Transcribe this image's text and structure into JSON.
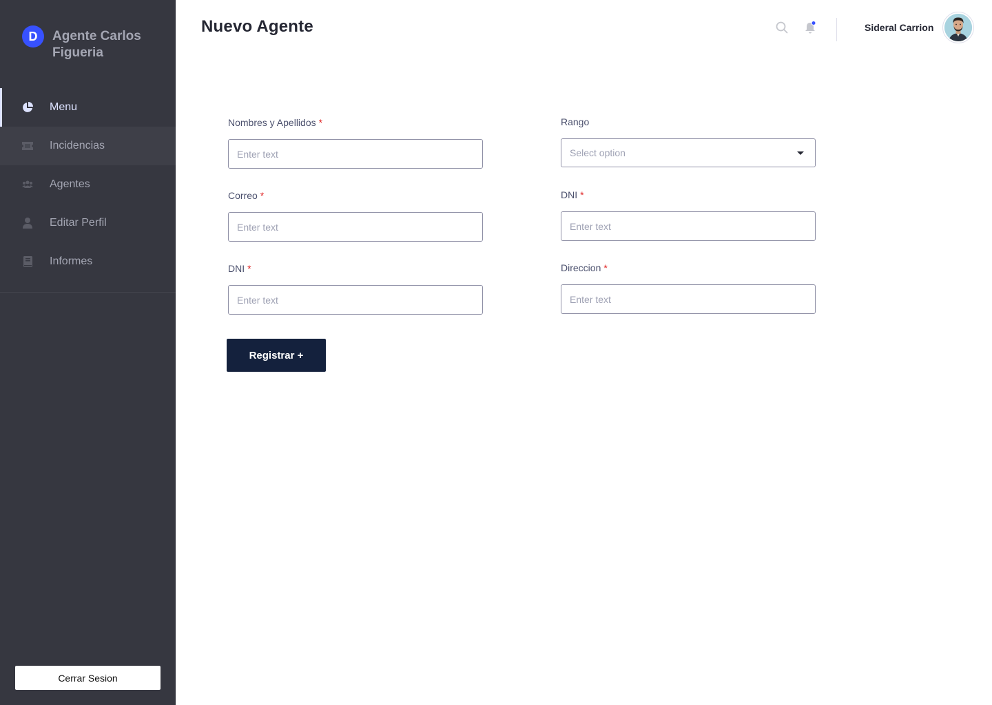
{
  "brand": {
    "logo_letter": "D",
    "title": "Agente Carlos Figueria",
    "accent": "#3751ff"
  },
  "sidebar": {
    "items": [
      {
        "label": "Menu",
        "icon": "pie-chart-icon"
      },
      {
        "label": "Incidencias",
        "icon": "ticket-icon"
      },
      {
        "label": "Agentes",
        "icon": "users-icon"
      },
      {
        "label": "Editar Perfil",
        "icon": "user-icon"
      },
      {
        "label": "Informes",
        "icon": "book-icon"
      }
    ],
    "logout_label": "Cerrar Sesion"
  },
  "header": {
    "title": "Nuevo Agente",
    "user_name": "Sideral Carrion"
  },
  "form": {
    "left": [
      {
        "label": "Nombres y Apellidos",
        "required": "*",
        "placeholder": "Enter text"
      },
      {
        "label": "Correo",
        "required": "*",
        "placeholder": "Enter text"
      },
      {
        "label": "DNI",
        "required": "*",
        "placeholder": "Enter text"
      }
    ],
    "right": [
      {
        "label": "Rango",
        "placeholder": "Select option"
      },
      {
        "label": "DNI",
        "required": "*",
        "placeholder": "Enter text"
      },
      {
        "label": "Direccion",
        "required": "*",
        "placeholder": "Enter text"
      }
    ],
    "submit_label": "Registrar +"
  },
  "colors": {
    "sidebar_bg": "#363740",
    "button_bg": "#14213d",
    "required": "#e02424",
    "notification_dot": "#3751ff"
  }
}
